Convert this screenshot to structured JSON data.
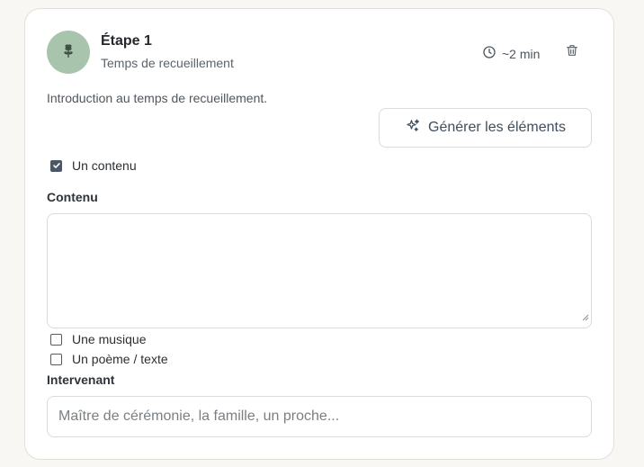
{
  "step": {
    "title": "Étape 1",
    "subtitle": "Temps de recueillement",
    "duration": "~2 min",
    "description": "Introduction au temps de recueillement."
  },
  "actions": {
    "generate_label": "Générer les éléments"
  },
  "options": [
    {
      "label": "Un contenu",
      "checked": true
    },
    {
      "label": "Une musique",
      "checked": false
    },
    {
      "label": "Un poème / texte",
      "checked": false
    }
  ],
  "content_field": {
    "label": "Contenu",
    "value": ""
  },
  "speaker_field": {
    "label": "Intervenant",
    "placeholder": "Maître de cérémonie, la famille, un proche..."
  },
  "colors": {
    "avatar_bg": "#a9c4ac",
    "checkbox_checked": "#4a5866"
  },
  "icons": {
    "avatar": "flower-icon",
    "duration": "clock-icon",
    "delete": "trash-icon",
    "generate": "sparkles-icon"
  }
}
